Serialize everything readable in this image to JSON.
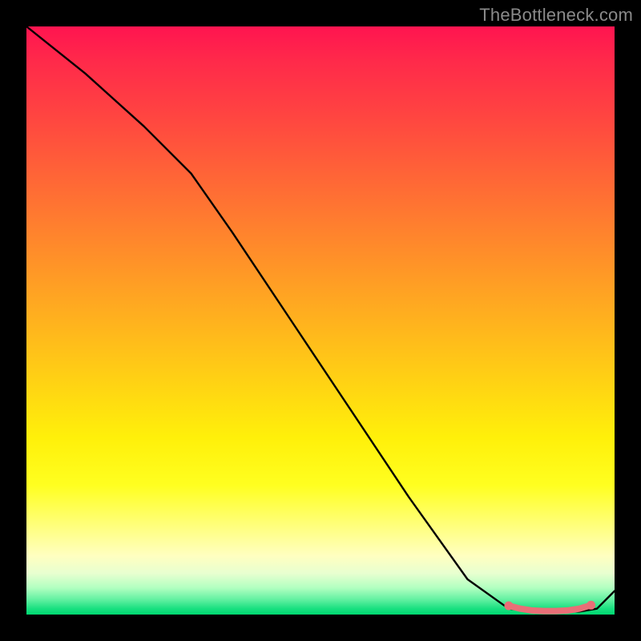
{
  "watermark": "TheBottleneck.com",
  "chart_data": {
    "type": "line",
    "title": "",
    "xlabel": "",
    "ylabel": "",
    "xlim": [
      0,
      100
    ],
    "ylim": [
      0,
      100
    ],
    "series": [
      {
        "name": "curve",
        "x": [
          0,
          10,
          20,
          28,
          35,
          45,
          55,
          65,
          75,
          82,
          86,
          90,
          94,
          97,
          100
        ],
        "values": [
          100,
          92,
          83,
          75,
          65,
          50,
          35,
          20,
          6,
          1,
          0.5,
          0.5,
          0.5,
          1,
          4
        ]
      }
    ],
    "markers": {
      "name": "highlight-segment",
      "color": "#e96f77",
      "x": [
        82,
        84,
        86,
        88,
        90,
        92,
        94,
        96
      ],
      "values": [
        1.5,
        1.0,
        0.7,
        0.6,
        0.6,
        0.7,
        1.0,
        1.6
      ]
    }
  }
}
